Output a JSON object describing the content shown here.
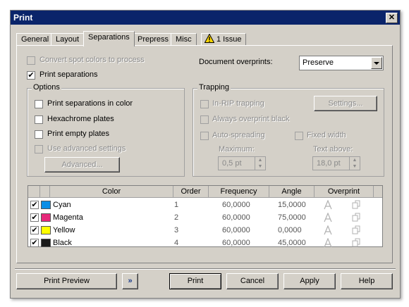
{
  "window": {
    "title": "Print",
    "close_glyph": "✕"
  },
  "tabs": [
    {
      "label": "General"
    },
    {
      "label": "Layout"
    },
    {
      "label": "Separations"
    },
    {
      "label": "Prepress"
    },
    {
      "label": "Misc"
    },
    {
      "label": "1 Issue",
      "icon": "warning-icon"
    }
  ],
  "separations": {
    "convert_spot_colors": {
      "label": "Convert spot colors to process",
      "checked": false,
      "enabled": false
    },
    "print_separations": {
      "label": "Print separations",
      "checked": true
    },
    "document_overprints_label": "Document overprints:",
    "document_overprints_value": "Preserve"
  },
  "options": {
    "title": "Options",
    "items": [
      {
        "label": "Print separations in color",
        "checked": false
      },
      {
        "label": "Hexachrome plates",
        "checked": false
      },
      {
        "label": "Print empty plates",
        "checked": false
      },
      {
        "label": "Use advanced settings",
        "checked": false,
        "enabled": false
      }
    ],
    "advanced_button": "Advanced..."
  },
  "trapping": {
    "title": "Trapping",
    "in_rip": "In-RIP trapping",
    "settings_button": "Settings...",
    "always_overprint_black": "Always overprint black",
    "auto_spreading": "Auto-spreading",
    "fixed_width": "Fixed width",
    "maximum_label": "Maximum:",
    "maximum_value": "0,5 pt",
    "text_above_label": "Text above:",
    "text_above_value": "18,0 pt"
  },
  "table": {
    "headers": [
      "Color",
      "Order",
      "Frequency",
      "Angle",
      "Overprint"
    ],
    "rows": [
      {
        "checked": true,
        "color_name": "Cyan",
        "swatch": "#0a8ee6",
        "order": "1",
        "frequency": "60,0000",
        "angle": "15,0000"
      },
      {
        "checked": true,
        "color_name": "Magenta",
        "swatch": "#e6287a",
        "order": "2",
        "frequency": "60,0000",
        "angle": "75,0000"
      },
      {
        "checked": true,
        "color_name": "Yellow",
        "swatch": "#ffff00",
        "order": "3",
        "frequency": "60,0000",
        "angle": "0,0000"
      },
      {
        "checked": true,
        "color_name": "Black",
        "swatch": "#1a1a1a",
        "order": "4",
        "frequency": "60,0000",
        "angle": "45,0000"
      }
    ]
  },
  "footer": {
    "print_preview": "Print Preview",
    "expand_glyph": "»",
    "print": "Print",
    "cancel": "Cancel",
    "apply": "Apply",
    "help": "Help"
  }
}
